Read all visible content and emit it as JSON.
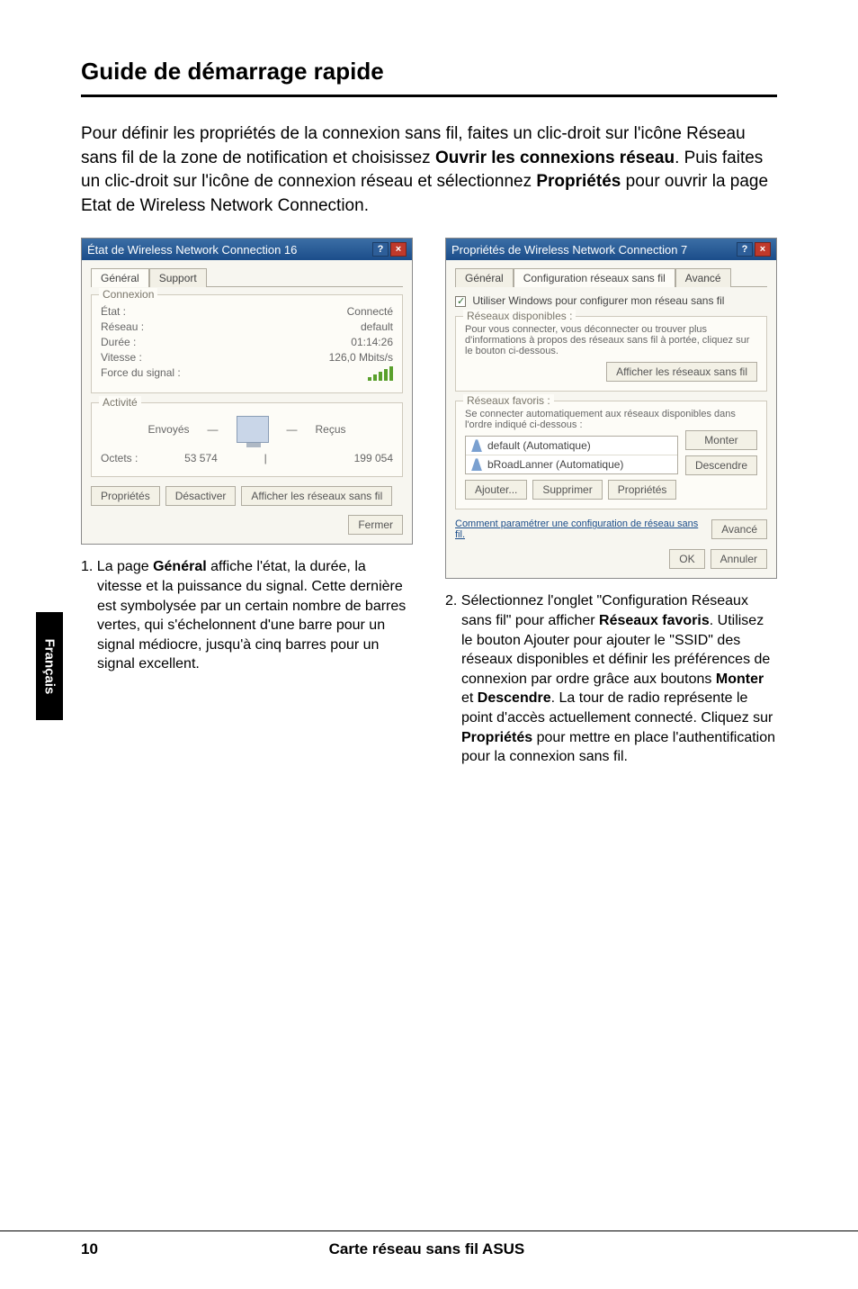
{
  "title": "Guide de démarrage rapide",
  "intro": {
    "t1": "Pour définir les propriétés de la connexion sans fil, faites un clic-droit sur l'icône Réseau sans fil de la zone de notification et choisissez ",
    "b1": "Ouvrir les connexions réseau",
    "t2": ". Puis faites un clic-droit sur l'icône de connexion réseau et sélectionnez ",
    "b2": "Propriétés",
    "t3": " pour ouvrir la page Etat de Wireless Network Connection."
  },
  "dlg_left": {
    "titlebar": "État de Wireless Network Connection 16",
    "tabs": {
      "general": "Général",
      "support": "Support"
    },
    "group_conn": {
      "legend": "Connexion",
      "etat_l": "État :",
      "etat_v": "Connecté",
      "reseau_l": "Réseau :",
      "reseau_v": "default",
      "duree_l": "Durée :",
      "duree_v": "01:14:26",
      "vitesse_l": "Vitesse :",
      "vitesse_v": "126,0 Mbits/s",
      "force_l": "Force du signal :"
    },
    "group_act": {
      "legend": "Activité",
      "envoyes": "Envoyés",
      "recus": "Reçus",
      "octets_l": "Octets :",
      "env_v": "53 574",
      "rec_v": "199 054"
    },
    "buttons": {
      "prop": "Propriétés",
      "desact": "Désactiver",
      "aff": "Afficher les réseaux sans fil"
    },
    "close": "Fermer"
  },
  "dlg_right": {
    "titlebar": "Propriétés de Wireless Network Connection 7",
    "tabs": {
      "general": "Général",
      "conf": "Configuration réseaux sans fil",
      "adv": "Avancé"
    },
    "chk": "Utiliser Windows pour configurer mon réseau sans fil",
    "group1": {
      "legend": "Réseaux disponibles :",
      "desc": "Pour vous connecter, vous déconnecter ou trouver plus d'informations à propos des réseaux sans fil à portée, cliquez sur le bouton ci-dessous.",
      "btn": "Afficher les réseaux sans fil"
    },
    "group2": {
      "legend": "Réseaux favoris :",
      "desc": "Se connecter automatiquement aux réseaux disponibles dans l'ordre indiqué ci-dessous :",
      "item1": "default (Automatique)",
      "item2": "bRoadLanner (Automatique)",
      "monter": "Monter",
      "descendre": "Descendre",
      "ajouter": "Ajouter...",
      "supprimer": "Supprimer",
      "proprietes": "Propriétés"
    },
    "footer": {
      "desc": "Comment paramétrer une configuration de réseau sans fil.",
      "avance": "Avancé"
    },
    "ok": "OK",
    "annuler": "Annuler"
  },
  "caption_left": {
    "lead": "1. La page ",
    "b1": "Général",
    "rest": " affiche l'état, la durée, la vitesse et la puissance du signal. Cette dernière est symbolysée par un certain nombre de barres vertes, qui s'échelonnent d'une barre pour un signal médiocre, jusqu'à cinq barres pour un signal excellent."
  },
  "caption_right": {
    "lead": "2. Sélectionnez l'onglet \"Configuration Réseaux sans fil\" pour afficher ",
    "b1": "Réseaux favoris",
    "mid1": ". Utilisez le bouton Ajouter pour ajouter le \"SSID\" des réseaux disponibles et définir les préférences de connexion par ordre grâce aux boutons ",
    "b2": "Monter",
    "mid2": " et ",
    "b3": "Descendre",
    "mid3": ". La tour de radio représente le point d'accès actuellement connecté. Cliquez sur ",
    "b4": "Propriétés",
    "rest": " pour mettre en place l'authentification pour la connexion sans fil."
  },
  "sidetab": "Français",
  "footer": {
    "page": "10",
    "product": "Carte réseau sans fil ASUS"
  }
}
